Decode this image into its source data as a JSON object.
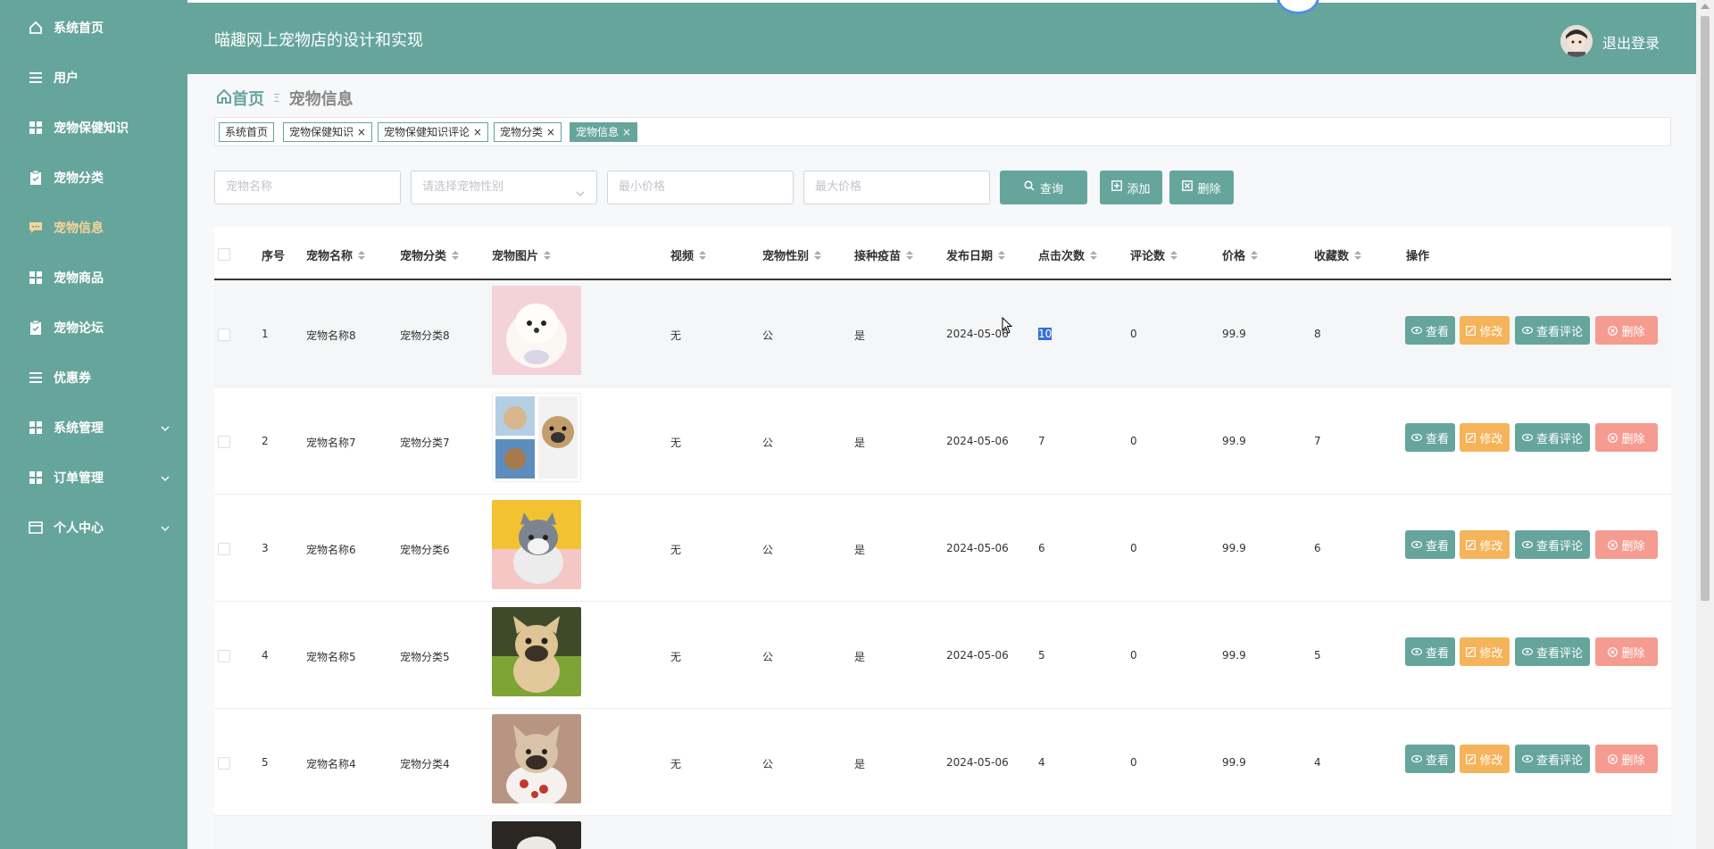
{
  "colors": {
    "theme": "#65a59c",
    "edit": "#f5b35a",
    "delete": "#f59b90",
    "active_menu_text": "#f8d39a"
  },
  "sidebar": {
    "items": [
      {
        "label": "系统首页",
        "icon": "home-icon"
      },
      {
        "label": "用户",
        "icon": "list-icon"
      },
      {
        "label": "宠物保健知识",
        "icon": "grid-icon"
      },
      {
        "label": "宠物分类",
        "icon": "clipboard-icon"
      },
      {
        "label": "宠物信息",
        "icon": "chat-icon",
        "active": true
      },
      {
        "label": "宠物商品",
        "icon": "grid-icon"
      },
      {
        "label": "宠物论坛",
        "icon": "clipboard-icon"
      },
      {
        "label": "优惠券",
        "icon": "list-icon"
      },
      {
        "label": "系统管理",
        "icon": "grid-icon",
        "expandable": true
      },
      {
        "label": "订单管理",
        "icon": "grid-icon",
        "expandable": true
      },
      {
        "label": "个人中心",
        "icon": "card-icon",
        "expandable": true
      }
    ]
  },
  "header": {
    "title": "喵趣网上宠物店的设计和实现",
    "logout": "退出登录"
  },
  "breadcrumb": {
    "home": "首页",
    "separator": "Ξ",
    "current": "宠物信息"
  },
  "tags": [
    {
      "label": "系统首页",
      "closable": false
    },
    {
      "label": "宠物保健知识",
      "closable": true
    },
    {
      "label": "宠物保健知识评论",
      "closable": true
    },
    {
      "label": "宠物分类",
      "closable": true
    },
    {
      "label": "宠物信息",
      "closable": true,
      "active": true
    }
  ],
  "search": {
    "name_placeholder": "宠物名称",
    "gender_placeholder": "请选择宠物性别",
    "min_price_placeholder": "最小价格",
    "max_price_placeholder": "最大价格",
    "query": "查询",
    "add": "添加",
    "delete": "删除"
  },
  "table": {
    "headers": {
      "index": "序号",
      "name": "宠物名称",
      "category": "宠物分类",
      "image": "宠物图片",
      "video": "视频",
      "gender": "宠物性别",
      "vaccine": "接种疫苗",
      "date": "发布日期",
      "clicks": "点击次数",
      "comments": "评论数",
      "price": "价格",
      "favorites": "收藏数",
      "actions": "操作"
    },
    "actions": {
      "view": "查看",
      "edit": "修改",
      "view_comments": "查看评论",
      "delete": "删除"
    },
    "rows": [
      {
        "index": "1",
        "name": "宠物名称8",
        "category": "宠物分类8",
        "video": "无",
        "gender": "公",
        "vaccine": "是",
        "date": "2024-05-06",
        "clicks": "10",
        "comments": "0",
        "price": "99.9",
        "favorites": "8",
        "image": "white-pomeranian-photo"
      },
      {
        "index": "2",
        "name": "宠物名称7",
        "category": "宠物分类7",
        "video": "无",
        "gender": "公",
        "vaccine": "是",
        "date": "2024-05-06",
        "clicks": "7",
        "comments": "0",
        "price": "99.9",
        "favorites": "7",
        "image": "chihuahua-pug-collage"
      },
      {
        "index": "3",
        "name": "宠物名称6",
        "category": "宠物分类6",
        "video": "无",
        "gender": "公",
        "vaccine": "是",
        "date": "2024-05-06",
        "clicks": "6",
        "comments": "0",
        "price": "99.9",
        "favorites": "6",
        "image": "gray-kitten-photo"
      },
      {
        "index": "4",
        "name": "宠物名称5",
        "category": "宠物分类5",
        "video": "无",
        "gender": "公",
        "vaccine": "是",
        "date": "2024-05-06",
        "clicks": "5",
        "comments": "0",
        "price": "99.9",
        "favorites": "5",
        "image": "french-bulldog-grass-photo"
      },
      {
        "index": "5",
        "name": "宠物名称4",
        "category": "宠物分类4",
        "video": "无",
        "gender": "公",
        "vaccine": "是",
        "date": "2024-05-06",
        "clicks": "4",
        "comments": "0",
        "price": "99.9",
        "favorites": "4",
        "image": "french-bulldog-sweater-photo"
      }
    ]
  }
}
